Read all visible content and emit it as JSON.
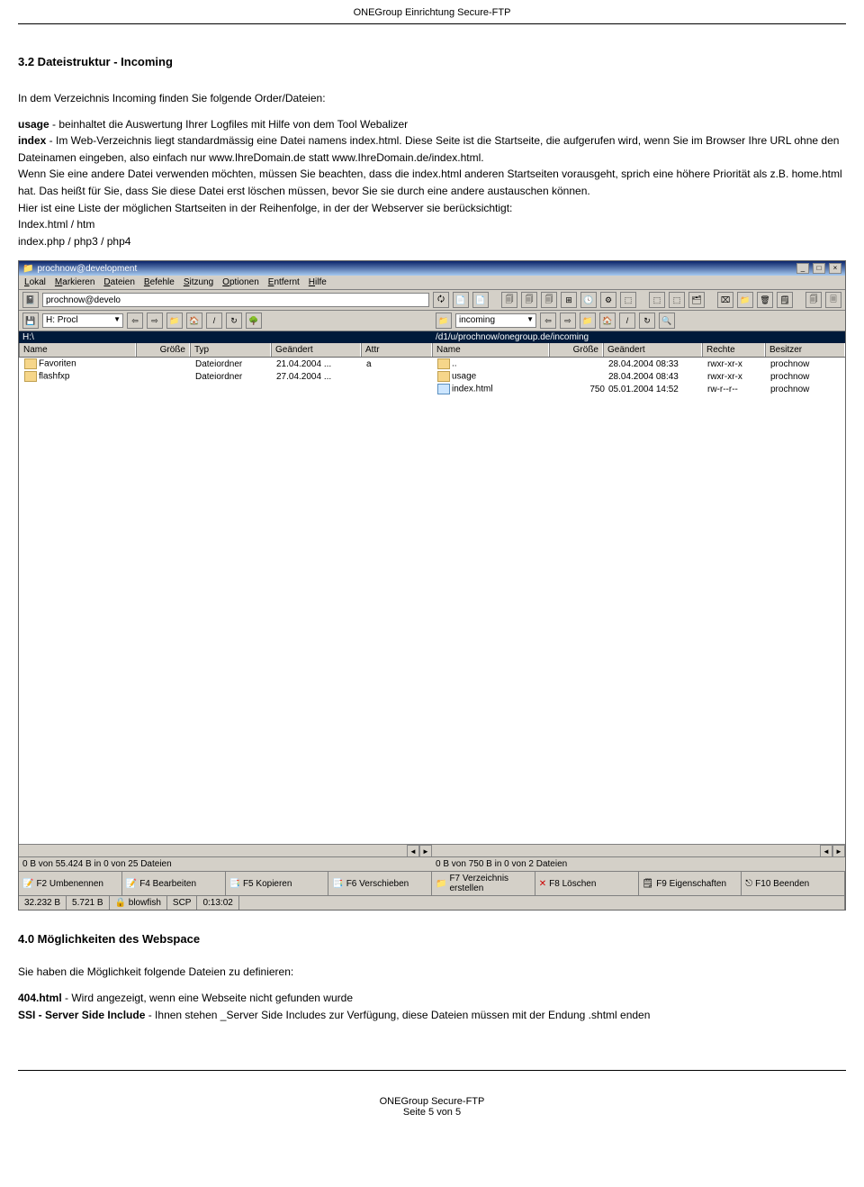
{
  "header": {
    "title": "ONEGroup Einrichtung Secure-FTP"
  },
  "section32": {
    "title": "3.2 Dateistruktur - Incoming",
    "intro": "In dem Verzeichnis Incoming finden Sie folgende Order/Dateien:",
    "usage_label": "usage",
    "usage_text": " - beinhaltet die Auswertung Ihrer Logfiles mit Hilfe von dem Tool Webalizer",
    "index_label": "index",
    "index_text": " - Im Web-Verzeichnis liegt standardmässig eine Datei namens index.html. Diese Seite ist die Startseite, die aufgerufen wird, wenn Sie im Browser Ihre URL ohne den Dateinamen eingeben, also einfach nur www.IhreDomain.de statt www.IhreDomain.de/index.html.",
    "body2": "Wenn Sie eine andere Datei verwenden möchten, müssen Sie beachten, dass die index.html anderen Startseiten vorausgeht, sprich eine höhere Priorität als z.B. home.html hat. Das heißt für Sie, dass Sie diese Datei erst löschen müssen, bevor Sie sie durch eine andere austauschen können.",
    "body3": "Hier ist eine Liste der möglichen Startseiten in der Reihenfolge, in der der Webserver sie berücksichtigt:",
    "l1": "Index.html / htm",
    "l2": "index.php / php3 / php4"
  },
  "app": {
    "title": "prochnow@development",
    "menu": {
      "lokal": "Lokal",
      "markieren": "Markieren",
      "dateien": "Dateien",
      "befehle": "Befehle",
      "sitzung": "Sitzung",
      "optionen": "Optionen",
      "entfernt": "Entfernt",
      "hilfe": "Hilfe"
    },
    "toolbar_input": "prochnow@develo",
    "left_drop": "H: Procl",
    "right_drop": "incoming",
    "left_path": "H:\\",
    "right_path": "/d1/u/prochnow/onegroup.de/incoming",
    "lcols": {
      "name": "Name",
      "groesse": "Größe",
      "typ": "Typ",
      "geaendert": "Geändert",
      "attr": "Attr"
    },
    "rcols": {
      "name": "Name",
      "groesse": "Größe",
      "geaendert": "Geändert",
      "rechte": "Rechte",
      "besitzer": "Besitzer"
    },
    "lrows": [
      {
        "name": "Favoriten",
        "typ": "Dateiordner",
        "geaendert": "21.04.2004 ...",
        "attr": "a"
      },
      {
        "name": "flashfxp",
        "typ": "Dateiordner",
        "geaendert": "27.04.2004 ...",
        "attr": ""
      }
    ],
    "rrows": [
      {
        "name": "..",
        "groesse": "",
        "geaendert": "28.04.2004 08:33",
        "rechte": "rwxr-xr-x",
        "besitzer": "prochnow"
      },
      {
        "name": "usage",
        "groesse": "",
        "geaendert": "28.04.2004 08:43",
        "rechte": "rwxr-xr-x",
        "besitzer": "prochnow"
      },
      {
        "name": "index.html",
        "groesse": "750",
        "geaendert": "05.01.2004 14:52",
        "rechte": "rw-r--r--",
        "besitzer": "prochnow"
      }
    ],
    "lstatus": "0 B von 55.424 B in 0 von 25 Dateien",
    "rstatus": "0 B von 750 B in 0 von 2 Dateien",
    "fkeys": {
      "f2": "F2 Umbenennen",
      "f4": "F4 Bearbeiten",
      "f5": "F5 Kopieren",
      "f6": "F6 Verschieben",
      "f7": "F7 Verzeichnis erstellen",
      "f8": "F8 Löschen",
      "f9": "F9 Eigenschaften",
      "f10": "F10 Beenden"
    },
    "stat": {
      "s1": "32.232 B",
      "s2": "5.721 B",
      "s3": "blowfish",
      "s4": "SCP",
      "s5": "0:13:02"
    }
  },
  "section40": {
    "title": "4.0 Möglichkeiten des Webspace",
    "intro": "Sie haben die Möglichkeit folgende Dateien zu definieren:",
    "l404_label": "404.html",
    "l404_text": " - Wird angezeigt, wenn eine Webseite nicht gefunden wurde",
    "ssi_label": "SSI - Server Side Include",
    "ssi_text": " - Ihnen stehen _Server Side Includes zur Verfügung, diese Dateien müssen mit der Endung .shtml enden"
  },
  "footer": {
    "l1": "ONEGroup Secure-FTP",
    "l2": "Seite 5 von 5"
  }
}
